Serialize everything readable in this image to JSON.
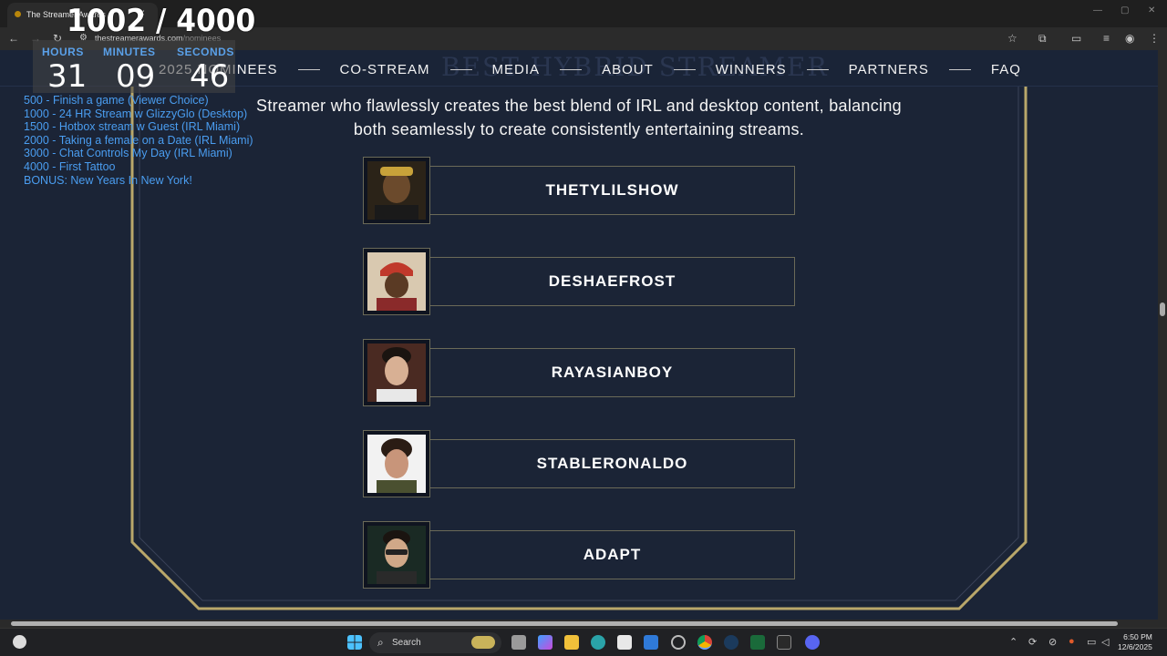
{
  "browser": {
    "tab_title": "The Streamer Awards",
    "url_host": "thestreamerawards.com",
    "url_path": "/nominees"
  },
  "nav": {
    "ghost_heading": "BEST HYBRID STREAMER",
    "items": [
      "2025 NOMINEES",
      "CO-STREAM",
      "MEDIA",
      "ABOUT",
      "WINNERS",
      "PARTNERS",
      "FAQ"
    ]
  },
  "category": {
    "description": "Streamer who flawlessly creates the best blend of IRL and desktop content, balancing both seamlessly to create consistently entertaining streams."
  },
  "nominees": [
    {
      "name": "THETYLILSHOW"
    },
    {
      "name": "DESHAEFROST"
    },
    {
      "name": "RAYASIANBOY"
    },
    {
      "name": "STABLERONALDO"
    },
    {
      "name": "ADAPT"
    }
  ],
  "overlay": {
    "sub_count": "1002 / 4000",
    "hours_label": "HOURS",
    "minutes_label": "MINUTES",
    "seconds_label": "SECONDS",
    "hours": "31",
    "minutes": "09",
    "seconds": "46",
    "goals": [
      " 500 -  Finish a game (Viewer Choice)",
      "1000 - 24 HR Stream w GlizzyGlo (Desktop)",
      "1500 - Hotbox stream w Guest (IRL Miami)",
      "2000 - Taking a female on a Date (IRL Miami)",
      "3000 - Chat Controls My Day (IRL Miami)",
      "4000 - First Tattoo",
      "BONUS: New Years In New York!"
    ]
  },
  "taskbar": {
    "search_placeholder": "Search",
    "time": "6:50 PM",
    "date": "12/6/2025"
  },
  "colors": {
    "page_bg": "#1b2436",
    "gold": "#b9a76a",
    "goal_blue": "#4a9df0",
    "label_blue": "#5aa0e8"
  }
}
